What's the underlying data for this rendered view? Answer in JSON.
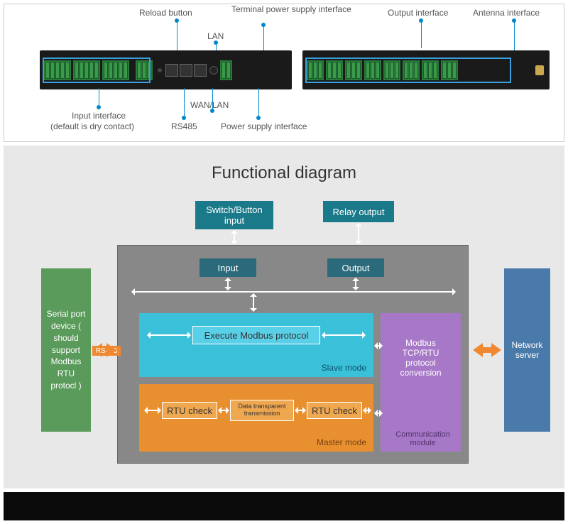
{
  "top": {
    "reload_button": "Reload button",
    "terminal_power": "Terminal power supply interface",
    "lan": "LAN",
    "output_interface": "Output interface",
    "antenna_interface": "Antenna interface",
    "input_interface": "Input interface",
    "input_default": "(default is dry contact)",
    "wan_lan": "WAN/LAN",
    "rs485": "RS485",
    "power_supply": "Power supply interface"
  },
  "func": {
    "title": "Functional diagram",
    "switch_button": "Switch/Button input",
    "relay_output": "Relay output",
    "input": "Input",
    "output": "Output",
    "execute_modbus": "Execute Modbus protocol",
    "slave_mode": "Slave mode",
    "rtu_check": "RTU check",
    "data_transparent": "Data transparent transmission",
    "master_mode": "Master mode",
    "modbus_conv": "Modbus TCP/RTU protocol conversion",
    "comm_module": "Communication module",
    "serial_device": "Serial port device ( should support Modbus RTU protocl )",
    "rs485": "RS485",
    "network_server": "Network server"
  }
}
